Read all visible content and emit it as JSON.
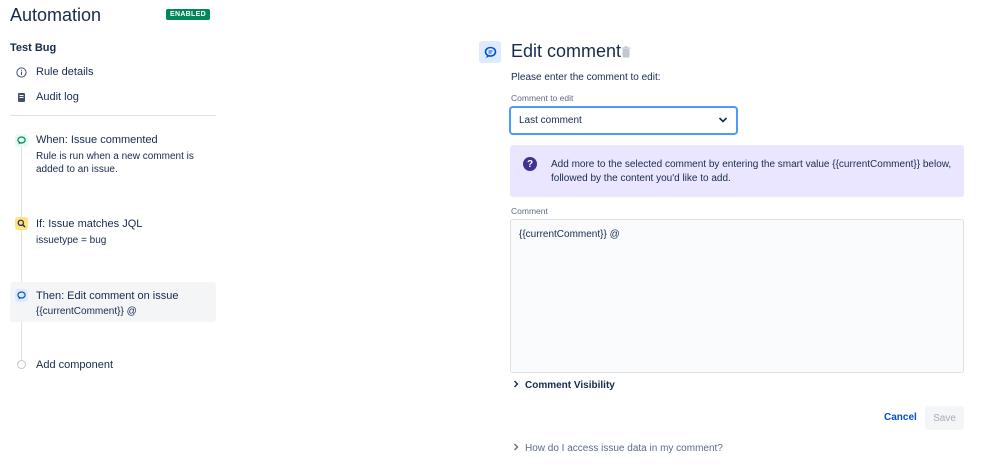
{
  "app": {
    "title": "Automation",
    "status_badge": "ENABLED"
  },
  "rule": {
    "name": "Test Bug",
    "nav": [
      {
        "label": "Rule details",
        "icon": "info-icon"
      },
      {
        "label": "Audit log",
        "icon": "document-icon"
      }
    ]
  },
  "steps": {
    "trigger": {
      "title": "When: Issue commented",
      "desc": "Rule is run when a new comment is added to an issue.",
      "icon": "comment-icon",
      "color": "#00875a",
      "bg": "#e3fcef"
    },
    "condition": {
      "title": "If: Issue matches JQL",
      "desc": "issuetype = bug",
      "icon": "search-icon",
      "color": "#172b4d",
      "bg": "#ffe380"
    },
    "action": {
      "title": "Then: Edit comment on issue",
      "desc": "{{currentComment}} @",
      "icon": "comment-icon",
      "color": "#0052cc",
      "bg": "#deebff"
    },
    "add_component": "Add component"
  },
  "editor": {
    "title": "Edit comment",
    "instruction": "Please enter the comment to edit:",
    "comment_to_edit_label": "Comment to edit",
    "comment_to_edit_value": "Last comment",
    "info_text": "Add more to the selected comment by entering the smart value {{currentComment}} below, followed by the content you'd like to add.",
    "comment_label": "Comment",
    "comment_value": "{{currentComment}} @",
    "visibility_label": "Comment Visibility",
    "cancel_label": "Cancel",
    "save_label": "Save",
    "help_link": "How do I access issue data in my comment?"
  },
  "colors": {
    "accent": "#0052cc",
    "enabled": "#00875a",
    "info_bg": "#eae6ff",
    "info_icon": "#403294"
  }
}
